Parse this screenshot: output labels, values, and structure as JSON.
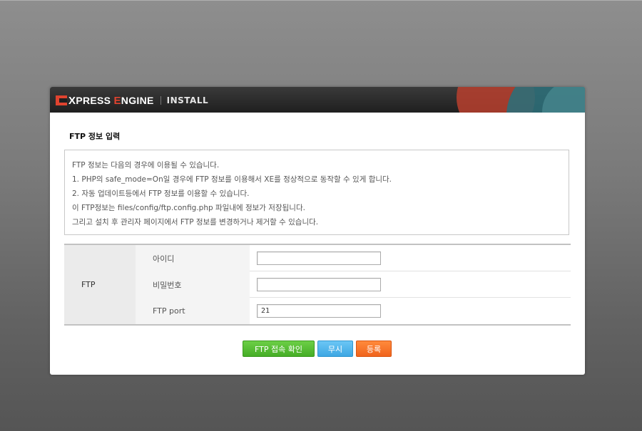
{
  "header": {
    "logo_mark_icon": "xpress-engine-logo",
    "logo_x": "X",
    "logo_press": "PRESS ",
    "logo_e": "E",
    "logo_ngine": "NGINE",
    "install_label": "INSTALL",
    "accent_color": "#e0432f"
  },
  "section_title": "FTP 정보 입력",
  "info_lines": [
    "FTP 정보는 다음의 경우에 이용될 수 있습니다.",
    "1. PHP의 safe_mode=On일 경우에 FTP 정보를 이용해서 XE를 정상적으로 동작할 수 있게 합니다.",
    "2. 자동 업데이트등에서 FTP 정보를 이용할 수 있습니다.",
    "이 FTP정보는 files/config/ftp.config.php 파일내에 정보가 저장됩니다.",
    "그리고 설치 후 관리자 페이지에서 FTP 정보를 변경하거나 제거할 수 있습니다."
  ],
  "form": {
    "group_label": "FTP",
    "fields": [
      {
        "label": "아이디",
        "value": ""
      },
      {
        "label": "비밀번호",
        "value": ""
      },
      {
        "label": "FTP port",
        "value": "21"
      }
    ]
  },
  "buttons": {
    "check_label": "FTP 접속 확인",
    "skip_label": "무시",
    "register_label": "등록",
    "check_color": "#45ad26",
    "skip_color": "#3ea7e3",
    "register_color": "#f0641d"
  }
}
